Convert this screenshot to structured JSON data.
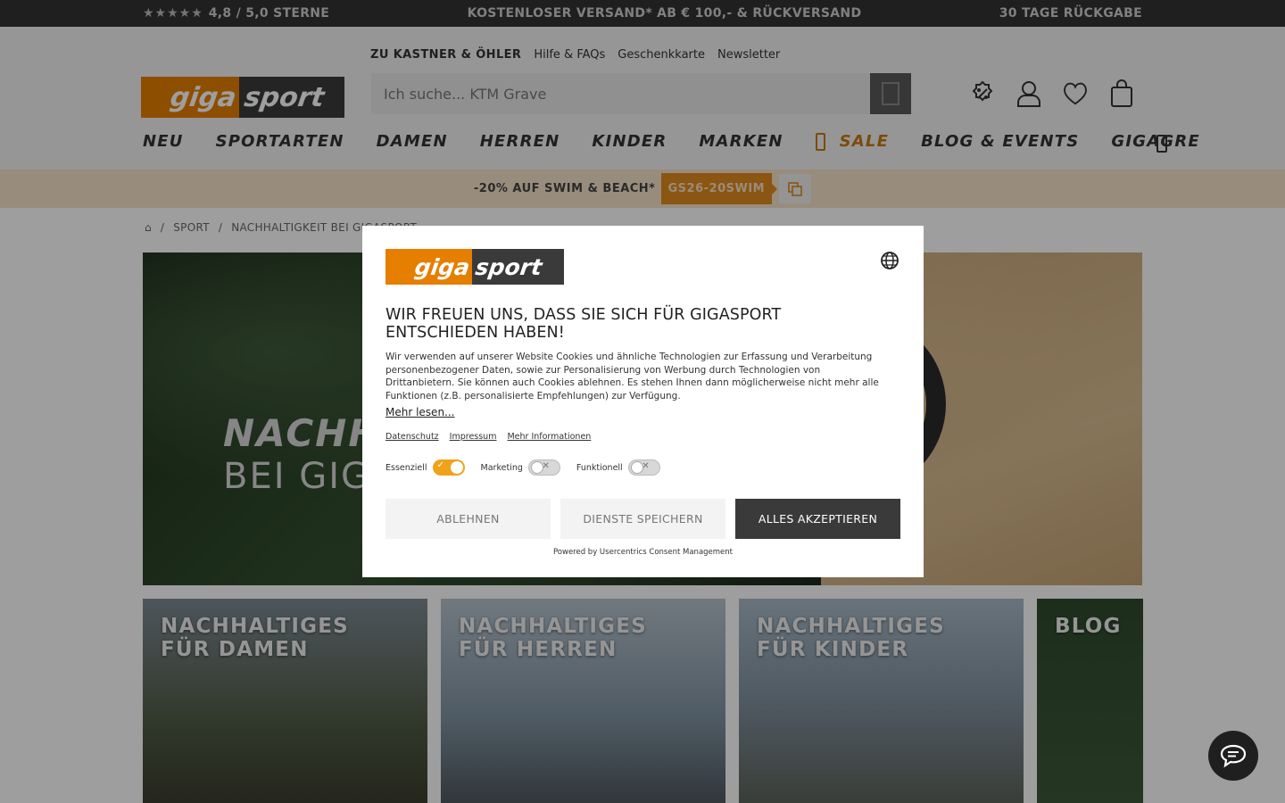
{
  "topbar": {
    "stars": "★★★★★",
    "rating": "4,8 / 5,0 STERNE",
    "shipping": "KOSTENLOSER VERSAND* AB € 100,- & RÜCKVERSAND",
    "returns": "30 TAGE RÜCKGABE"
  },
  "header": {
    "meta_links": [
      "ZU KASTNER & ÖHLER",
      "Hilfe & FAQs",
      "Geschenkkarte",
      "Newsletter"
    ],
    "logo_left": "giga",
    "logo_right": "sport",
    "search_placeholder": "Ich suche... KTM Grave",
    "icons": [
      "discount-icon",
      "account-icon",
      "wishlist-icon",
      "cart-icon"
    ]
  },
  "nav": {
    "items": [
      "NEU",
      "SPORTARTEN",
      "DAMEN",
      "HERREN",
      "KINDER",
      "MARKEN",
      "SALE",
      "BLOG & EVENTS",
      "GIGAGRE"
    ]
  },
  "promo": {
    "text": "-20% AUF SWIM & BEACH*",
    "code": "GS26-20SWIM"
  },
  "breadcrumb": [
    "SPORT",
    "NACHHALTIGKEIT BEI GIGASPORT"
  ],
  "hero": {
    "line1": "NACHHALTIGKEIT",
    "line2": "BEI GIGASPORT"
  },
  "tiles": [
    {
      "line1": "NACHHALTIGES",
      "line2": "FÜR DAMEN"
    },
    {
      "line1": "NACHHALTIGES",
      "line2": "FÜR HERREN"
    },
    {
      "line1": "NACHHALTIGES",
      "line2": "FÜR KINDER"
    },
    {
      "line1": "BLOG",
      "line2": ""
    }
  ],
  "modal": {
    "title": "WIR FREUEN UNS, DASS SIE SICH FÜR GIGASPORT ENTSCHIEDEN HABEN!",
    "body": "Wir verwenden auf unserer Website Cookies und ähnliche Technologien zur Erfassung und Verarbeitung personenbezogener Daten, sowie zur Personalisierung von Werbung durch Technologien von Drittanbietern. Sie können auch Cookies ablehnen. Es stehen Ihnen dann möglicherweise nicht mehr alle Funktionen (z.B. personalisierte Empfehlungen) zur Verfügung.",
    "more": "Mehr lesen...",
    "links": [
      "Datenschutz",
      "Impressum",
      "Mehr Informationen"
    ],
    "toggles": [
      {
        "label": "Essenziell",
        "state": "on"
      },
      {
        "label": "Marketing",
        "state": "off"
      },
      {
        "label": "Funktionell",
        "state": "off"
      }
    ],
    "buttons": {
      "decline": "ABLEHNEN",
      "save": "DIENSTE SPEICHERN",
      "accept": "ALLES AKZEPTIEREN"
    },
    "powered": "Powered by Usercentrics Consent Management"
  },
  "colors": {
    "brand_orange": "#e67e00",
    "dark": "#3a3a3a",
    "promo_bg": "#f6e2c9"
  }
}
